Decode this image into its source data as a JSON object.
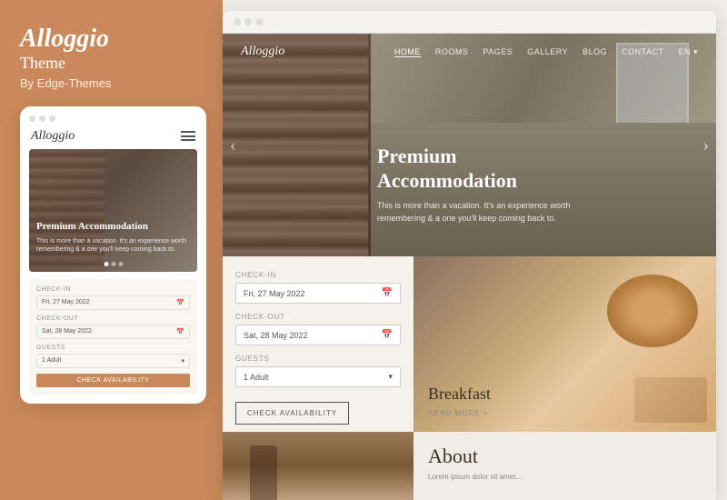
{
  "left": {
    "title": "Alloggio",
    "subtitle": "Theme",
    "by": "By Edge-Themes",
    "mobile": {
      "logo": "Alloggio",
      "hero_title": "Premium\nAccommodation",
      "hero_text": "This is more than a vacation. It's an experience worth remembering & a one you'll keep coming back to.",
      "checkin_label": "CHECK-IN",
      "checkin_value": "Fri, 27 May 2022",
      "checkout_label": "CHECK-OUT",
      "checkout_value": "Sat, 28 May 2022",
      "guests_label": "GUESTS",
      "guests_value": "1 Adult",
      "check_btn": "CHECK AVAILABILITY"
    }
  },
  "browser": {
    "dots": [
      "",
      "",
      ""
    ],
    "nav": {
      "logo": "Alloggio",
      "links": [
        "HOME",
        "ROOMS",
        "PAGES",
        "GALLERY",
        "BLOG",
        "CONTACT",
        "EN"
      ]
    },
    "hero": {
      "title": "Premium Accommodation",
      "text": "This is more than a vacation. It's an experience worth\nremembering & a one you'll keep coming back to."
    },
    "booking": {
      "checkin_label": "CHECK-IN",
      "checkin_value": "Fri, 27 May 2022",
      "checkout_label": "CHECK-OUT",
      "checkout_value": "Sat, 28 May 2022",
      "guests_label": "GUESTS",
      "guests_value": "1 Adult",
      "btn_label": "CHECK AVAILABILITY"
    },
    "breakfast": {
      "title": "Breakfast",
      "read_more": "READ MORE +"
    },
    "about": {
      "title": "About"
    }
  }
}
